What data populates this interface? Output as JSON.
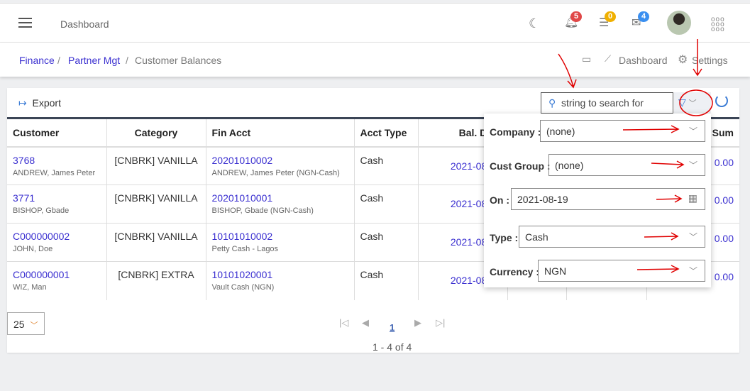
{
  "header": {
    "title": "Dashboard",
    "badges": {
      "notifications": "5",
      "tasks": "0",
      "messages": "4"
    }
  },
  "breadcrumb": {
    "items": [
      "Finance",
      "Partner Mgt",
      "Customer Balances"
    ],
    "links": {
      "dashboard": "Dashboard",
      "settings": "Settings"
    }
  },
  "toolbar": {
    "export": "Export",
    "search_placeholder": "string to search for"
  },
  "table": {
    "headers": [
      "Customer",
      "Category",
      "Fin Acct",
      "Acct Type",
      "Bal. Date",
      "",
      "",
      "Sum"
    ],
    "rows": [
      {
        "customer": "3768",
        "customer_name": "ANDREW, James Peter",
        "category": "[CNBRK] VANILLA",
        "fin_acct": "20201010002",
        "fin_acct_name": "ANDREW, James Peter (NGN-Cash)",
        "acct_type": "Cash",
        "bal_date": "2021-08-19",
        "sum": "0.00"
      },
      {
        "customer": "3771",
        "customer_name": "BISHOP, Gbade",
        "category": "[CNBRK] VANILLA",
        "fin_acct": "20201010001",
        "fin_acct_name": "BISHOP, Gbade (NGN-Cash)",
        "acct_type": "Cash",
        "bal_date": "2021-08-19",
        "sum": "0.00"
      },
      {
        "customer": "C000000002",
        "customer_name": "JOHN, Doe",
        "category": "[CNBRK] VANILLA",
        "fin_acct": "10101010002",
        "fin_acct_name": "Petty Cash - Lagos",
        "acct_type": "Cash",
        "bal_date": "2021-08-19",
        "sum": "0.00"
      },
      {
        "customer": "C000000001",
        "customer_name": "WIZ, Man",
        "category": "[CNBRK] EXTRA",
        "fin_acct": "10101020001",
        "fin_acct_name": "Vault Cash (NGN)",
        "acct_type": "Cash",
        "bal_date": "2021-08-19",
        "sum": "0.00"
      }
    ]
  },
  "pagination": {
    "page_size": "25",
    "current_page": "1",
    "summary": "1 - 4 of 4"
  },
  "filter": {
    "company_label": "Company :",
    "company": "(none)",
    "cust_group_label": "Cust Group :",
    "cust_group": "(none)",
    "on_label": "On :",
    "on": "2021-08-19",
    "type_label": "Type :",
    "type": "Cash",
    "currency_label": "Currency :",
    "currency": "NGN"
  },
  "colors": {
    "link": "#3a2fd0",
    "annotation": "#e00000",
    "table_border": "#3b4556"
  }
}
